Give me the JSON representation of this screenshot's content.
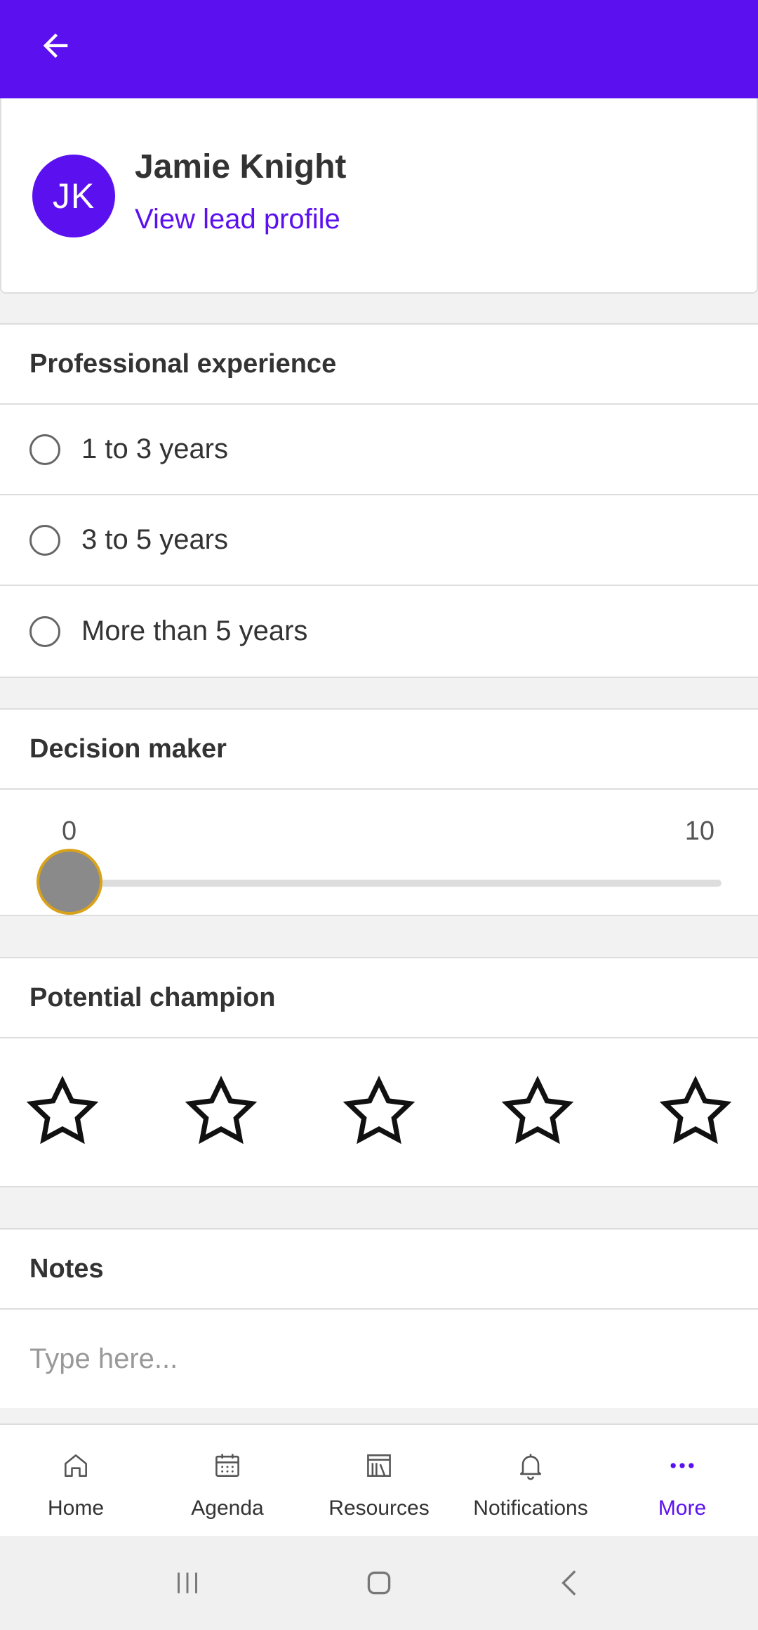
{
  "lead": {
    "initials": "JK",
    "name": "Jamie Knight",
    "profile_link": "View lead profile"
  },
  "experience": {
    "title": "Professional experience",
    "options": [
      {
        "label": "1 to 3 years",
        "selected": false
      },
      {
        "label": "3 to 5 years",
        "selected": false
      },
      {
        "label": "More than 5 years",
        "selected": false
      }
    ]
  },
  "decision_maker": {
    "title": "Decision maker",
    "min_label": "0",
    "max_label": "10",
    "value": 0
  },
  "champion": {
    "title": "Potential champion",
    "rating": 0,
    "max_rating": 5
  },
  "notes": {
    "title": "Notes",
    "placeholder": "Type here...",
    "value": ""
  },
  "nav": {
    "items": [
      {
        "label": "Home",
        "icon": "home-icon",
        "active": false
      },
      {
        "label": "Agenda",
        "icon": "calendar-icon",
        "active": false
      },
      {
        "label": "Resources",
        "icon": "library-icon",
        "active": false
      },
      {
        "label": "Notifications",
        "icon": "bell-icon",
        "active": false
      },
      {
        "label": "More",
        "icon": "more-icon",
        "active": true
      }
    ]
  },
  "colors": {
    "primary": "#5b10f0",
    "slider_thumb_border": "#d9a21b",
    "slider_thumb_fill": "#8a8a8a"
  }
}
